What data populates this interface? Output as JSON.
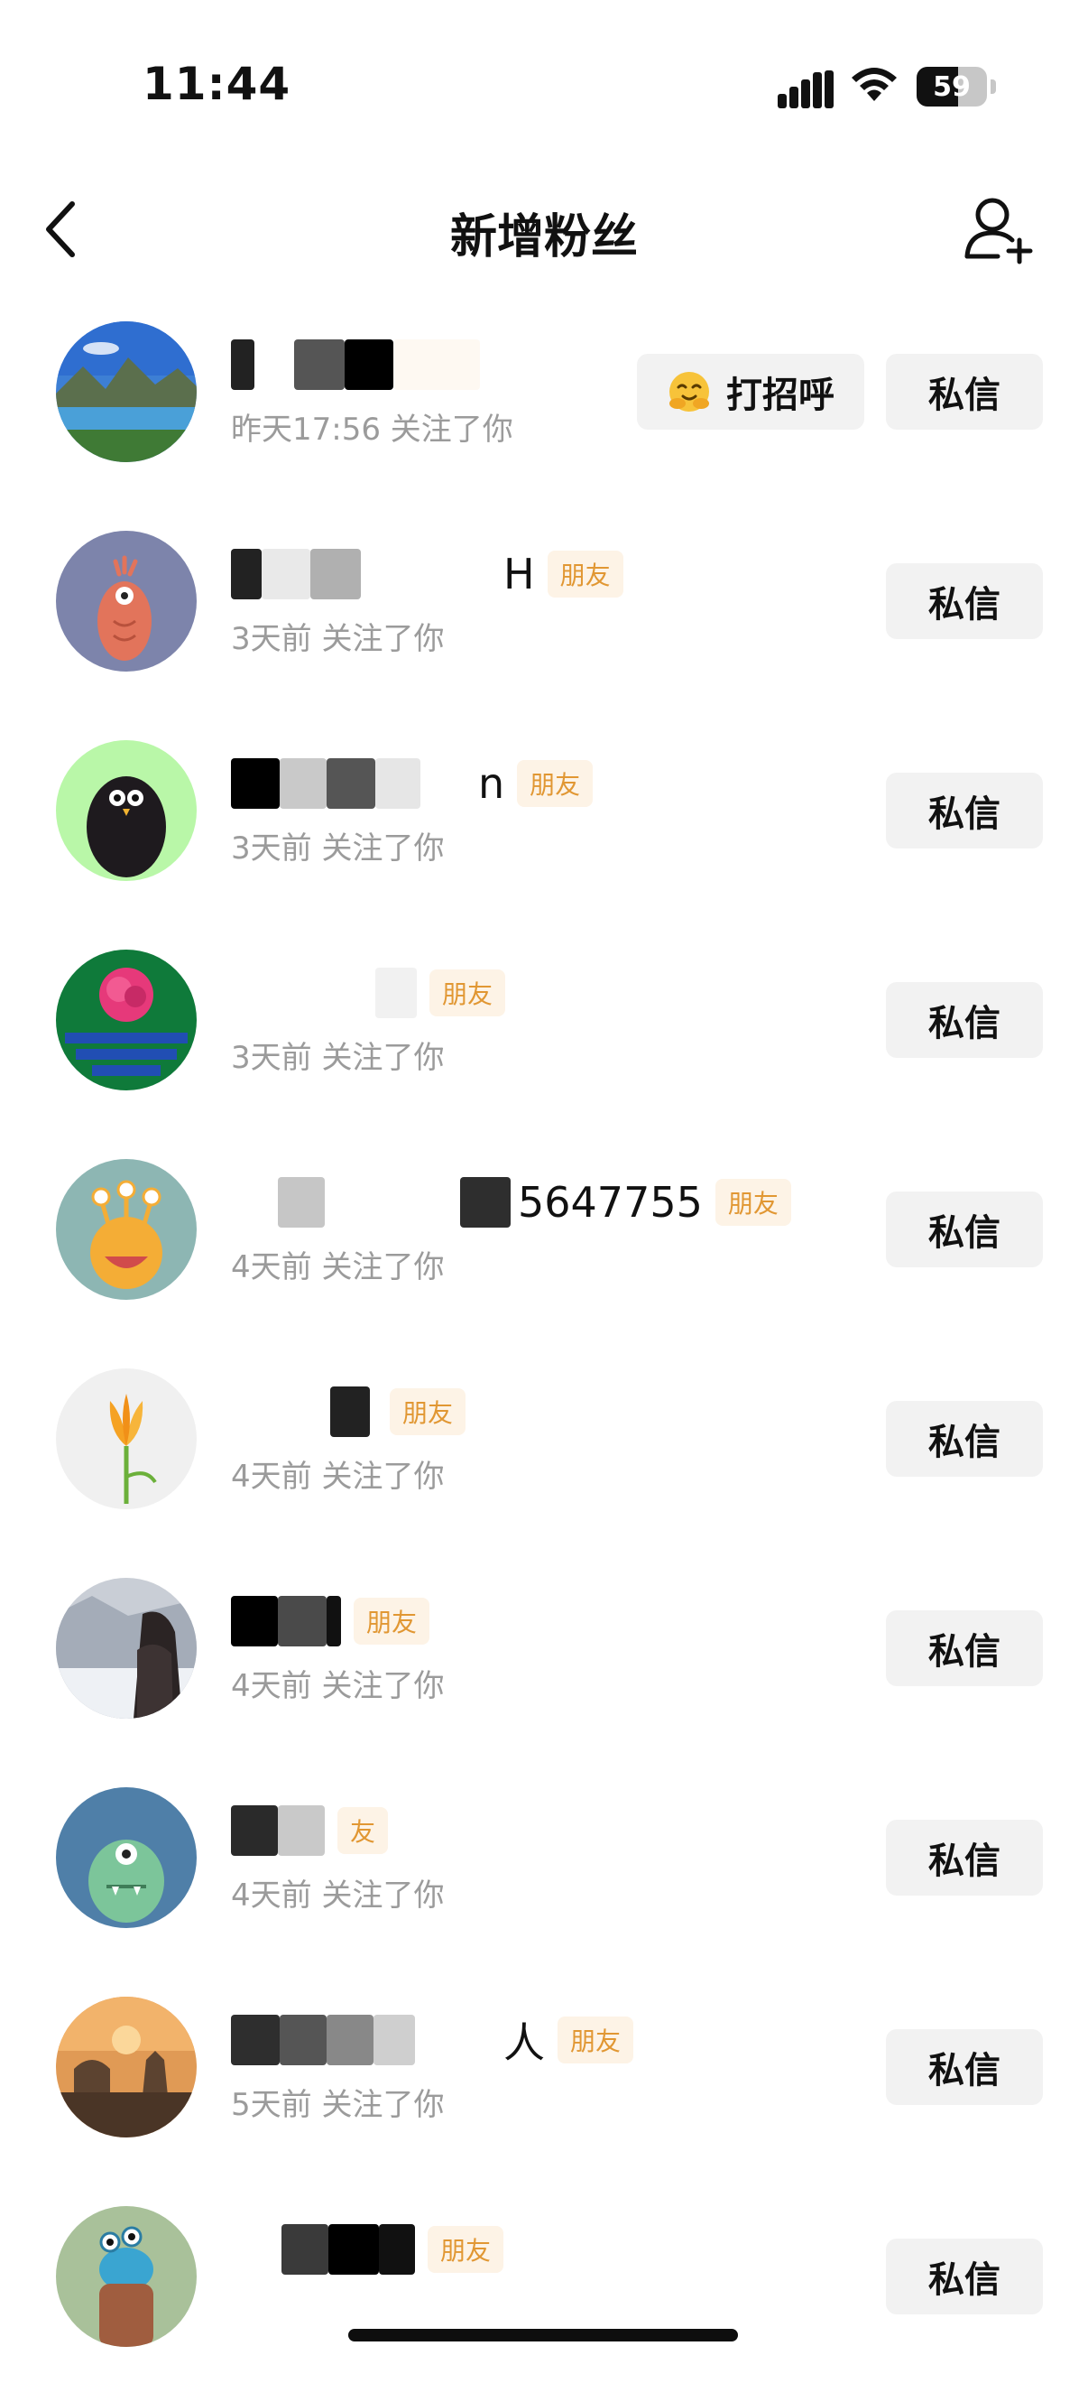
{
  "status_bar": {
    "time": "11:44",
    "battery_level": "59",
    "battery_fraction": 0.59
  },
  "header": {
    "title": "新增粉丝",
    "back_icon": "chevron-left-icon",
    "add_icon": "add-friend-icon"
  },
  "colors": {
    "friend_badge_bg": "#fdf3e6",
    "friend_badge_text": "#e19733",
    "button_bg": "#f2f2f2",
    "secondary_text": "#9b9b9b"
  },
  "fans": [
    {
      "name_visible": "",
      "badge": "",
      "follow_time": "昨天17:56 关注了你",
      "greet_label": "打招呼",
      "message_label": "私信"
    },
    {
      "name_visible": "H",
      "badge": "朋友",
      "follow_time": "3天前 关注了你",
      "message_label": "私信"
    },
    {
      "name_visible": "n",
      "badge": "朋友",
      "follow_time": "3天前 关注了你",
      "message_label": "私信"
    },
    {
      "name_visible": "",
      "badge": "朋友",
      "follow_time": "3天前 关注了你",
      "message_label": "私信"
    },
    {
      "name_visible": "5647755",
      "badge": "朋友",
      "follow_time": "4天前 关注了你",
      "message_label": "私信"
    },
    {
      "name_visible": "",
      "badge": "朋友",
      "follow_time": "4天前 关注了你",
      "message_label": "私信"
    },
    {
      "name_visible": "",
      "badge": "朋友",
      "follow_time": "4天前 关注了你",
      "message_label": "私信"
    },
    {
      "name_visible": "",
      "badge": "友",
      "follow_time": "4天前 关注了你",
      "message_label": "私信"
    },
    {
      "name_visible": "人",
      "badge": "朋友",
      "follow_time": "5天前 关注了你",
      "message_label": "私信"
    },
    {
      "name_visible": "",
      "badge": "朋友",
      "follow_time": "",
      "message_label": "私信"
    }
  ]
}
